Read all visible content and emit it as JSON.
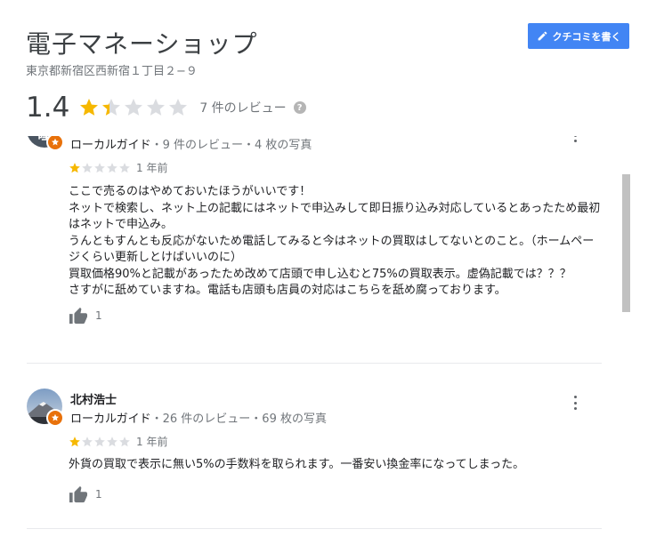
{
  "place": {
    "title": "電子マネーショップ",
    "address": "東京都新宿区西新宿１丁目２−９"
  },
  "write_review_button": {
    "label": "クチコミを書く",
    "color": "#4285f4"
  },
  "summary": {
    "rating": "1.4",
    "rating_value": 1.4,
    "review_count_text": "7 件のレビュー",
    "help_glyph": "?"
  },
  "star_colors": {
    "filled": "#f6b800",
    "empty": "#dadce0"
  },
  "reviews": [
    {
      "avatar_initial": "瞳",
      "name": "",
      "role": "ローカルガイド",
      "stats": "・9 件のレビュー・4 枚の写真",
      "stars": 1,
      "time": "1 年前",
      "lines": [
        "ここで売るのはやめておいたほうがいいです！",
        "ネットで検索し、ネット上の記載にはネットで申込みして即日振り込み対応しているとあったため最初",
        "はネットで申込み。",
        "うんともすんとも反応がないため電話してみると今はネットの買取はしてないとのこと。（ホームペー",
        "ジくらい更新しとけばいいのに）",
        "買取価格90%と記載があったため改めて店頭で申し込むと75%の買取表示。虚偽記載では？？？",
        "さすがに舐めていますね。電話も店頭も店員の対応はこちらを舐め腐っております。"
      ],
      "likes": "1"
    },
    {
      "name": "北村浩士",
      "role": "ローカルガイド",
      "stats": "・26 件のレビュー・69 枚の写真",
      "stars": 1,
      "time": "1 年前",
      "lines": [
        "外貨の買取で表示に無い5%の手数料を取られます。一番安い換金率になってしまった。"
      ],
      "likes": "1"
    }
  ]
}
